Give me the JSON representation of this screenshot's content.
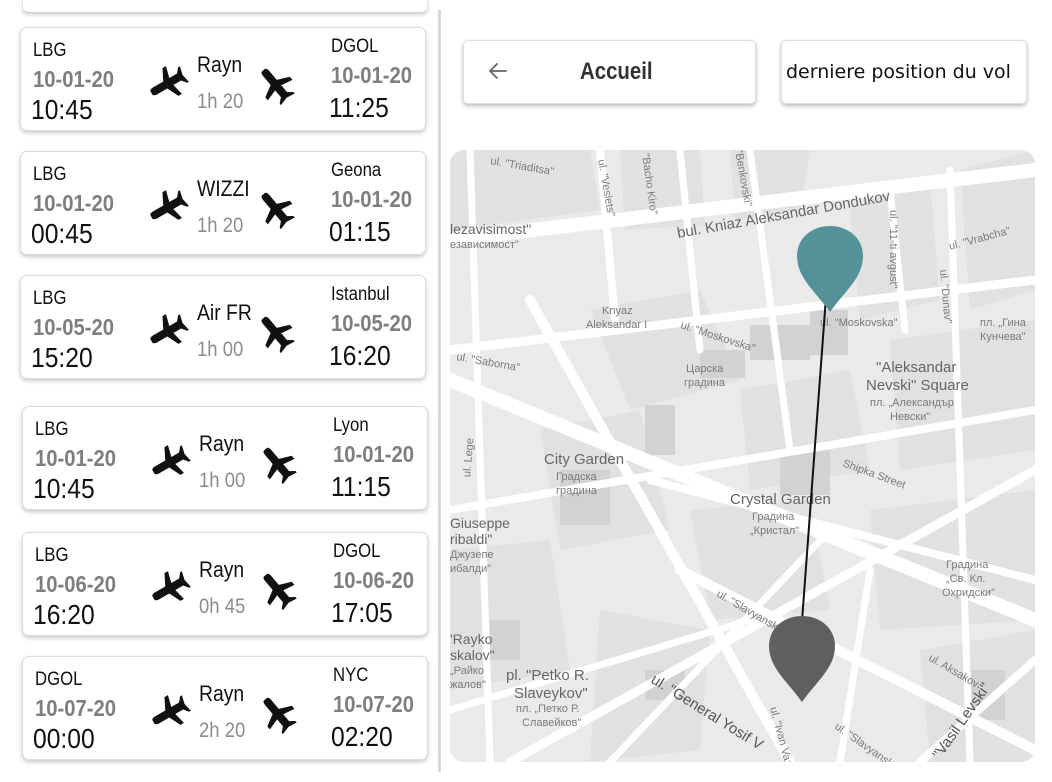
{
  "flights": [
    {
      "origin": "LBG",
      "depart_date": "10-01-20",
      "depart_time": "10:45",
      "airline": "Rayn",
      "duration": "1h 20",
      "destination": "DGOL",
      "arrive_date": "10-01-20",
      "arrive_time": "11:25"
    },
    {
      "origin": "LBG",
      "depart_date": "10-01-20",
      "depart_time": "00:45",
      "airline": "WIZZI",
      "duration": "1h 20",
      "destination": "Geona",
      "arrive_date": "10-01-20",
      "arrive_time": "01:15"
    },
    {
      "origin": "LBG",
      "depart_date": "10-05-20",
      "depart_time": "15:20",
      "airline": "Air FR",
      "duration": "1h 00",
      "destination": "Istanbul",
      "arrive_date": "10-05-20",
      "arrive_time": "16:20"
    },
    {
      "origin": "LBG",
      "depart_date": "10-01-20",
      "depart_time": "10:45",
      "airline": "Rayn",
      "duration": "1h 00",
      "destination": "Lyon",
      "arrive_date": "10-01-20",
      "arrive_time": "11:15"
    },
    {
      "origin": "LBG",
      "depart_date": "10-06-20",
      "depart_time": "16:20",
      "airline": "Rayn",
      "duration": "0h 45",
      "destination": "DGOL",
      "arrive_date": "10-06-20",
      "arrive_time": "17:05"
    },
    {
      "origin": "DGOL",
      "depart_date": "10-07-20",
      "depart_time": "00:00",
      "airline": "Rayn",
      "duration": "2h 20",
      "destination": "NYC",
      "arrive_date": "10-07-20",
      "arrive_time": "02:20"
    }
  ],
  "header": {
    "home_label": "Accueil",
    "last_position_label": "derniere position du vol"
  },
  "map": {
    "labels": [
      "ul. \"Triaditsa\"",
      "ul. \"Veslets\"",
      "\"Bacho Kiro\"",
      "\"Benkovski\"",
      "bul. Kniaz Aleksandar Dondukov",
      "lezavisimost\"",
      "езависимост\"",
      "ul. \"11-ti avgust\"",
      "ul. \"Vrabcha\"",
      "Knyaz",
      "Aleksandar I",
      "ul. \"Moskovska\"",
      "ul. \"Moskovska\"",
      "ul. \"Dunav\"",
      "пл. „Гина",
      "Кунчева\"",
      "ul. \"Saborna\"",
      "Царска",
      "градина",
      "\"Aleksandar",
      "Nevski\" Square",
      "пл. „Александър",
      "Невски\"",
      "City Garden",
      "Градска",
      "градина",
      "Shipka Street",
      "Crystal Garden",
      "Градина",
      "„Кристал\"",
      "ul. Lege",
      "Giuseppe",
      "ribaldi\"",
      "Джузепе",
      "ибалди\"",
      "Градина",
      "„Св. Кл.",
      "Охридски\"",
      "ul. \"Slavyanska\"",
      "'Rayko",
      "skalov\"",
      "„Райко",
      "жалов\"",
      "pl. \"Petko R.",
      "Slaveykov\"",
      "пл. „Петко Р.",
      "Славейков\"",
      "ul. \"General Yosif V",
      "ul. \"Ivan Vazov\"",
      "ul. \"Slavyanska\"",
      "ul. Aksakov",
      "\"Vasil Levski\""
    ],
    "pin_colors": {
      "current": "#54929a",
      "destination": "#5f5f5f"
    },
    "line_color": "#111111"
  }
}
